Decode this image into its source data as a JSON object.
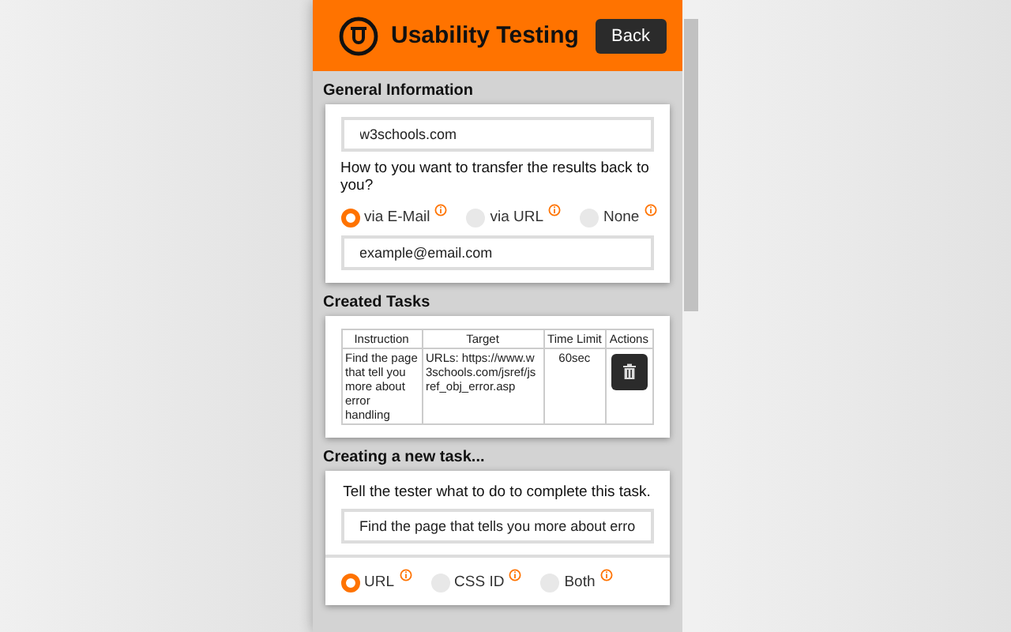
{
  "header": {
    "title": "Usability Testing",
    "back_button": "Back"
  },
  "general": {
    "heading": "General Information",
    "site_field": {
      "value": "w3schools.com"
    },
    "question": "How to you want to transfer the results back to you?",
    "options": [
      {
        "label": "via E-Mail",
        "selected": true
      },
      {
        "label": "via URL",
        "selected": false
      },
      {
        "label": "None",
        "selected": false
      }
    ],
    "email_field": {
      "value": "example@email.com"
    }
  },
  "created_tasks": {
    "heading": "Created Tasks",
    "columns": [
      "Instruction",
      "Target",
      "Time Limit",
      "Actions"
    ],
    "rows": [
      {
        "instruction": "Find the page that tell you more about error handling",
        "target": "URLs: https://www.w3schools.com/jsref/jsref_obj_error.asp",
        "time_limit": "60sec"
      }
    ]
  },
  "new_task": {
    "heading": "Creating a new task...",
    "prompt": "Tell the tester what to do to complete this task.",
    "instruction_field": {
      "value": "Find the page that tells you more about erro"
    },
    "target_types": [
      {
        "label": "URL",
        "selected": true
      },
      {
        "label": "CSS ID",
        "selected": false
      },
      {
        "label": "Both",
        "selected": false
      }
    ]
  }
}
